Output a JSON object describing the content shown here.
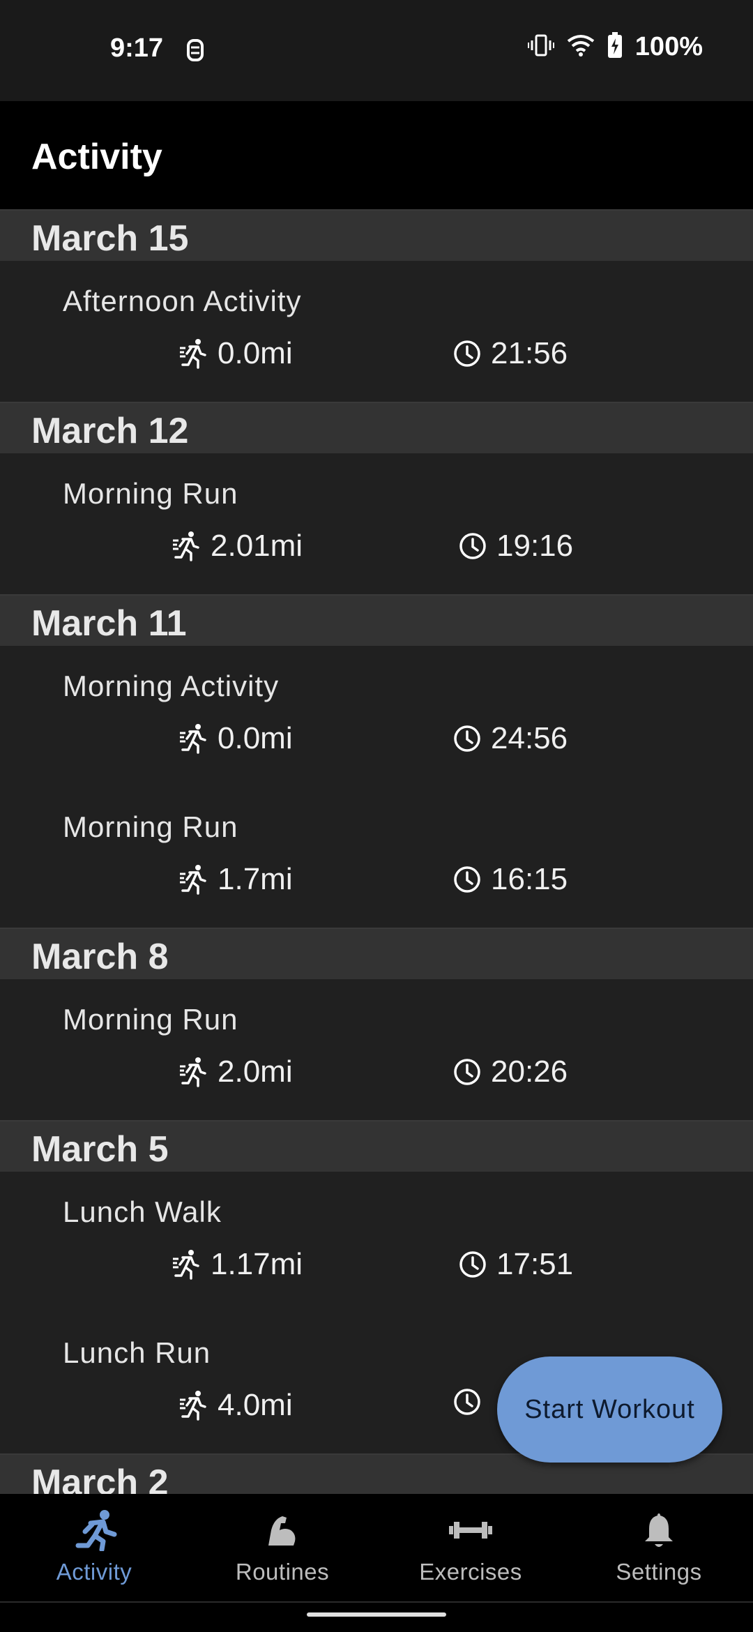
{
  "status": {
    "time": "9:17",
    "battery": "100%"
  },
  "app_bar": {
    "title": "Activity"
  },
  "groups": [
    {
      "date": "March 15",
      "activities": [
        {
          "name": "Afternoon Activity",
          "distance": "0.0mi",
          "duration": "21:56"
        }
      ]
    },
    {
      "date": "March 12",
      "activities": [
        {
          "name": "Morning Run",
          "distance": "2.01mi",
          "duration": "19:16"
        }
      ]
    },
    {
      "date": "March 11",
      "activities": [
        {
          "name": "Morning Activity",
          "distance": "0.0mi",
          "duration": "24:56"
        },
        {
          "name": "Morning Run",
          "distance": "1.7mi",
          "duration": "16:15"
        }
      ]
    },
    {
      "date": "March 8",
      "activities": [
        {
          "name": "Morning Run",
          "distance": "2.0mi",
          "duration": "20:26"
        }
      ]
    },
    {
      "date": "March 5",
      "activities": [
        {
          "name": "Lunch Walk",
          "distance": "1.17mi",
          "duration": "17:51"
        },
        {
          "name": "Lunch Run",
          "distance": "4.0mi",
          "duration": ""
        }
      ]
    },
    {
      "date": "March 2",
      "activities": []
    }
  ],
  "fab": {
    "label": "Start Workout"
  },
  "nav": {
    "items": [
      {
        "label": "Activity",
        "icon": "run-icon",
        "active": true
      },
      {
        "label": "Routines",
        "icon": "arm-icon",
        "active": false
      },
      {
        "label": "Exercises",
        "icon": "dumbbell-icon",
        "active": false
      },
      {
        "label": "Settings",
        "icon": "bell-icon",
        "active": false
      }
    ]
  },
  "colors": {
    "accent": "#6f9ad6",
    "background": "#202020",
    "header": "#333333",
    "app_bar": "#000000"
  }
}
